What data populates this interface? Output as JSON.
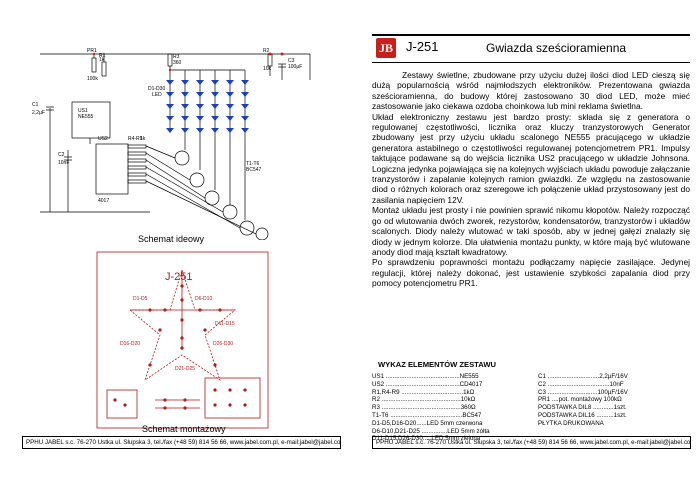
{
  "left": {
    "schematic_caption": "Schemat ideowy",
    "pcb_caption": "Schemat montażowy",
    "pcb_title": "J-251",
    "labels": {
      "pr1": "PR1",
      "pr1v": "100k",
      "r1": "R1",
      "r1v": "1k",
      "us1": "US1",
      "us1v": "NE555",
      "c1": "C1",
      "c1v": "2,2µF",
      "c2": "C2",
      "c2v": "10nF",
      "r3": "R3",
      "r3v": "360",
      "leds": "D1-D30",
      "led": "LED",
      "r2": "R2",
      "r2v": "10k",
      "c3": "C3",
      "c3v": "100µF",
      "r49": "R4-R9",
      "r49v": "1k",
      "us2": "US2",
      "us2v": "4017",
      "t": "T1-T6",
      "tv": "BC547",
      "pcb_d1": "D1-D5",
      "pcb_d6": "D6-D10",
      "pcb_d11": "D11-D15",
      "pcb_d16": "D16-D20",
      "pcb_d21": "D21-D25",
      "pcb_d26": "D26-D30"
    },
    "footer": "PPHU JABEL s.c. 76-270 Ustka ul. Słupska 3, tel./fax (+48 59) 814 56 66, www.jabel.com.pl, e-mail:jabel@jabel.com.pl"
  },
  "right": {
    "logo": "JB",
    "code": "J-251",
    "title": "Gwiazda sześcioramienna",
    "paragraphs": [
      "Zestawy świetlne, zbudowane przy użyciu dużej ilości diod LED cieszą się dużą popularnością wśród najmłodszych elektroników. Prezentowana gwiazda sześcioramienna, do budowy której zastosowano 30 diod LED, może mieć zastosowanie jako ciekawa ozdoba choinkowa lub mini reklama świetlna.",
      "Układ elektroniczny zestawu jest bardzo prosty: składa się z generatora o regulowanej częstotliwości, licznika oraz kluczy tranzystorowych Generator zbudowany jest przy użyciu układu scalonego NE555 pracującego w układzie generatora astabilnego o częstotliwości regulowanej potencjometrem PR1. Impulsy taktujące podawane są do wejścia licznika US2 pracującego w układzie Johnsona. Logiczna jedynka pojawiająca się na kolejnych wyjściach układu powoduje załączanie tranzystorów i zapalanie kolejnych ramion gwiazdki. Ze względu na zastosowanie diod o różnych kolorach oraz szeregowe ich połączenie układ przystosowany jest do zasilania napięciem 12V.",
      "Montaż układu jest prosty i nie powinien sprawić nikomu kłopotów. Należy rozpocząć go od wlutowania dwóch zworek, rezystorów, kondensatorów, tranzystorów i układów scalonych. Diody należy wlutować w taki sposób, aby w jednej gałęzi znalazły się diody w jednym kolorze. Dla ułatwienia montażu punkty, w które mają być wlutowane anody diod mają kształt kwadratowy.",
      "Po sprawdzeniu poprawności montażu podłączamy napięcie zasilające. Jedynej regulacji, której należy dokonać, jest ustawienie szybkości zapalania diod przy pomocy potencjometru PR1."
    ],
    "parts_heading": "WYKAZ ELEMENTÓW ZESTAWU",
    "parts_col1": [
      "US1 ...........................................NE555",
      "US2 ...........................................CD4017",
      "R1,R4-R9 ....................................1kΩ",
      "R2 ..............................................10kΩ",
      "R3 ..............................................360Ω",
      "T1-T6 ..........................................BC547",
      "D1-D5,D16-D20......LED 5mm czerwona",
      "D6-D10,D21-D25 ...............LED 5mm żółta",
      "D11-D15,D26-D30.....LED 5mm zielona"
    ],
    "parts_col2": [
      "C1 ..............................2,2µF/16V",
      "C2 ....................................10nF",
      "C3 .............................100µF/16V",
      "PR1 ....pot. montażowy 100kΩ",
      "PODSTAWKA DIL8 ............1szt.",
      "PODSTAWKA DIL16 ..........1szt.",
      "PŁYTKA DRUKOWANA"
    ],
    "footer": "PPHU JABEL s.c. 76-270 Ustka ul. Słupska 3, tel./fax (+48 59) 814 56 66, www.jabel.com.pl, e-mail:jabel@jabel.com.pl"
  },
  "colors": {
    "red": "#c8201d",
    "pcb": "#b01a1a",
    "led": "#1a3fc4"
  }
}
